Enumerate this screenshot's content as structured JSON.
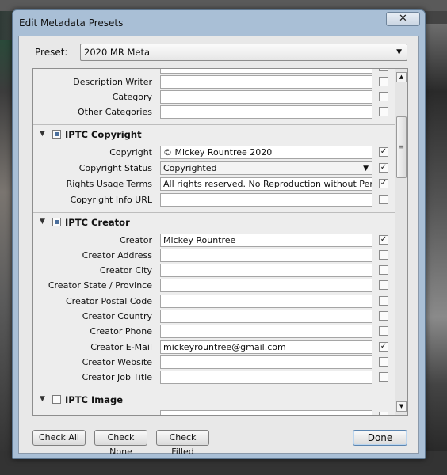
{
  "window": {
    "title": "Edit Metadata Presets",
    "close_symbol": "✕"
  },
  "preset": {
    "label": "Preset:",
    "value": "2020 MR Meta"
  },
  "rows_top": [
    {
      "label": "Description Writer",
      "value": "",
      "checked": false
    },
    {
      "label": "Category",
      "value": "",
      "checked": false
    },
    {
      "label": "Other Categories",
      "value": "",
      "checked": false
    }
  ],
  "sections": {
    "copyright": {
      "title": "IPTC Copyright"
    },
    "creator": {
      "title": "IPTC Creator"
    },
    "image": {
      "title": "IPTC Image"
    }
  },
  "copyright_rows": [
    {
      "label": "Copyright",
      "value": "© Mickey Rountree 2020",
      "checked": true
    },
    {
      "label": "Copyright Status",
      "value": "Copyrighted",
      "checked": true,
      "dropdown": true
    },
    {
      "label": "Rights Usage Terms",
      "value": "All rights reserved. No Reproduction without Permission",
      "checked": true
    },
    {
      "label": "Copyright Info URL",
      "value": "",
      "checked": false
    }
  ],
  "creator_rows": [
    {
      "label": "Creator",
      "value": "Mickey Rountree",
      "checked": true
    },
    {
      "label": "Creator Address",
      "value": "",
      "checked": false
    },
    {
      "label": "Creator City",
      "value": "",
      "checked": false
    },
    {
      "label": "Creator State / Province",
      "value": "",
      "checked": false
    },
    {
      "label": "Creator Postal Code",
      "value": "",
      "checked": false
    },
    {
      "label": "Creator Country",
      "value": "",
      "checked": false
    },
    {
      "label": "Creator Phone",
      "value": "",
      "checked": false
    },
    {
      "label": "Creator E-Mail",
      "value": "mickeyrountree@gmail.com",
      "checked": true
    },
    {
      "label": "Creator Website",
      "value": "",
      "checked": false
    },
    {
      "label": "Creator Job Title",
      "value": "",
      "checked": false
    }
  ],
  "buttons": {
    "check_all": "Check All",
    "check_none": "Check None",
    "check_filled": "Check Filled",
    "done": "Done"
  },
  "colors": {
    "titlebar": "#a9bfd6",
    "client": "#e8e8e8",
    "accent": "#4b6f9c"
  }
}
